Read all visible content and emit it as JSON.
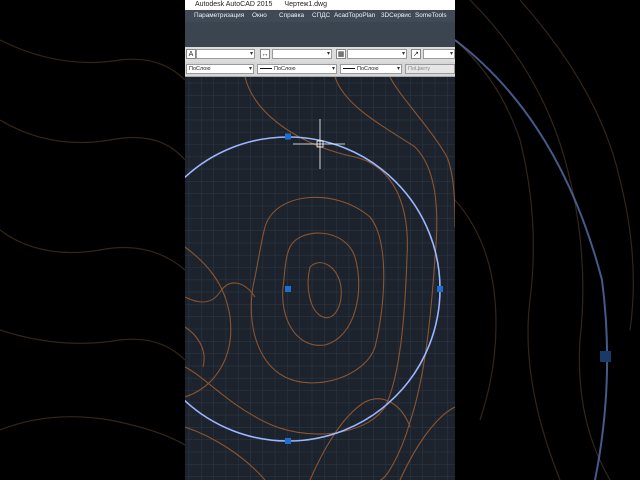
{
  "window": {
    "app_title": "Autodesk AutoCAD 2015",
    "document_title": "Чертеж1.dwg"
  },
  "menu": {
    "items": [
      {
        "label": "Параметризация"
      },
      {
        "label": "Окно"
      },
      {
        "label": "Справка"
      },
      {
        "label": "СПДС"
      },
      {
        "label": "AcadTopoPlan"
      },
      {
        "label": "3DСервис"
      },
      {
        "label": "SomeTools"
      }
    ]
  },
  "properties": {
    "color": "ПоСлою",
    "linetype": "ПоСлою",
    "lineweight": "ПоСлою",
    "plot_style": "ПоЦвету"
  },
  "colors": {
    "canvas_bg": "#1c232d",
    "grid": "#2c3643",
    "contour": "#8a5531",
    "circle": "#9bb6ff",
    "grip": "#1f6fd1",
    "outer_bg": "#000000"
  },
  "icons": {
    "text_style": "text-style-icon",
    "dim_style": "dimension-style-icon",
    "table_style": "table-style-icon",
    "mleader_style": "multileader-style-icon",
    "crosshair": "crosshair-cursor-icon"
  }
}
